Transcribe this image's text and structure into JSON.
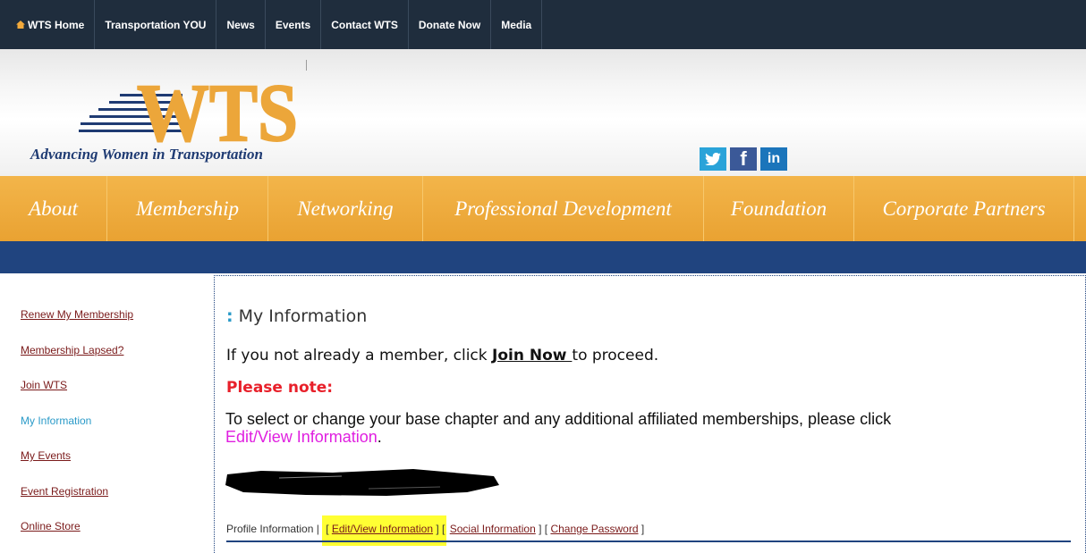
{
  "topnav": {
    "items": [
      "WTS Home",
      "Transportation YOU",
      "News",
      "Events",
      "Contact WTS",
      "Donate Now",
      "Media"
    ]
  },
  "banner": {
    "logo_text": "WTS",
    "tagline": "Advancing Women in Transportation",
    "social": [
      "twitter",
      "facebook",
      "linkedin"
    ]
  },
  "mainnav": {
    "items": [
      "About",
      "Membership",
      "Networking",
      "Professional Development",
      "Foundation",
      "Corporate Partners"
    ]
  },
  "sidebar": {
    "items": [
      "Renew My Membership",
      "Membership Lapsed?",
      "Join WTS",
      "My Information",
      "My Events",
      "Event Registration",
      "Online Store"
    ],
    "active": "My Information"
  },
  "main": {
    "title": "My Information",
    "line1_prefix": "If you not already a member, click ",
    "join_link": "Join Now ",
    "line1_suffix": " to proceed.",
    "note": "Please note:",
    "desc": "To select or change your base chapter and any additional affiliated memberships, please click ",
    "desc_link": "Edit/View Information",
    "desc_end": ".",
    "profile_label": "Profile Information",
    "sep": " | ",
    "links": [
      "Edit/View Information",
      "Social Information",
      "Change Password"
    ]
  },
  "colors": {
    "topbar": "#1f2d3d",
    "nav_orange": "#eaa535",
    "blue_band": "#20447f",
    "active_link": "#2a9ac8",
    "note_red": "#e8202a",
    "highlight": "#ffff33"
  }
}
